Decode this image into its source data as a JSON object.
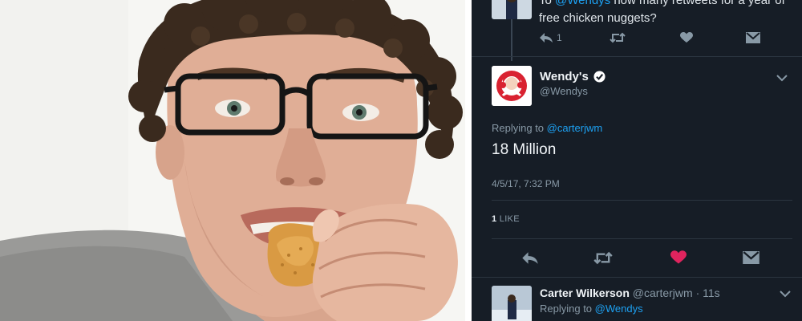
{
  "photo": {
    "subject": "teen-eating-chicken-nugget-photo"
  },
  "parent_tweet": {
    "prefix": "To ",
    "mention": "@Wendys",
    "text": " how many retweets for a year of free chicken nuggets?",
    "reply_count": "1"
  },
  "main_tweet": {
    "author_name": "Wendy's",
    "author_handle": "@Wendys",
    "replying_prefix": "Replying to ",
    "replying_mention": "@carterjwm",
    "body": "18 Million",
    "timestamp": "4/5/17, 7:32 PM",
    "like_count": "1",
    "like_label": " LIKE",
    "colors": {
      "heart": "#e0245e",
      "link": "#1da1f2",
      "background": "#161d26"
    }
  },
  "reply_tweet": {
    "author_name": "Carter Wilkerson",
    "meta": " @carterjwm · 11s",
    "replying_prefix": "Replying to ",
    "replying_mention": "@Wendys"
  },
  "icons": [
    "reply-icon",
    "retweet-icon",
    "heart-icon",
    "dm-icon",
    "verified-icon",
    "chevron-down-icon"
  ]
}
